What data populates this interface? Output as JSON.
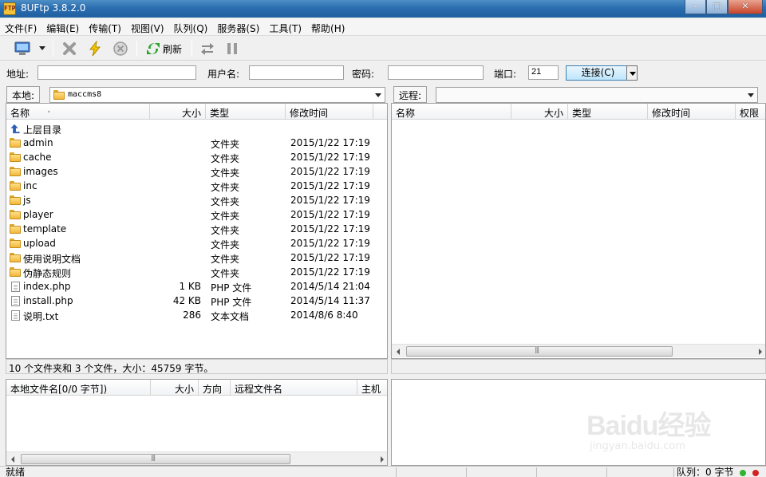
{
  "window": {
    "title": "8UFtp 3.8.2.0",
    "icon_text": "FTP"
  },
  "menu": [
    "文件(F)",
    "编辑(E)",
    "传输(T)",
    "视图(V)",
    "队列(Q)",
    "服务器(S)",
    "工具(T)",
    "帮助(H)"
  ],
  "toolbar": {
    "refresh_label": "刷新"
  },
  "connect": {
    "address_label": "地址:",
    "address_value": "",
    "user_label": "用户名:",
    "user_value": "",
    "password_label": "密码:",
    "password_value": "",
    "port_label": "端口:",
    "port_value": "21",
    "connect_button": "连接(C)"
  },
  "local": {
    "path_label": "本地:",
    "path_value": "maccms8",
    "columns": [
      "名称",
      "大小",
      "类型",
      "修改时间"
    ],
    "parent_dir": "上层目录",
    "files": [
      {
        "name": "admin",
        "size": "",
        "type": "文件夹",
        "modified": "2015/1/22 17:19",
        "icon": "folder-icon"
      },
      {
        "name": "cache",
        "size": "",
        "type": "文件夹",
        "modified": "2015/1/22 17:19",
        "icon": "folder-icon"
      },
      {
        "name": "images",
        "size": "",
        "type": "文件夹",
        "modified": "2015/1/22 17:19",
        "icon": "folder-icon"
      },
      {
        "name": "inc",
        "size": "",
        "type": "文件夹",
        "modified": "2015/1/22 17:19",
        "icon": "folder-icon"
      },
      {
        "name": "js",
        "size": "",
        "type": "文件夹",
        "modified": "2015/1/22 17:19",
        "icon": "folder-icon"
      },
      {
        "name": "player",
        "size": "",
        "type": "文件夹",
        "modified": "2015/1/22 17:19",
        "icon": "folder-icon"
      },
      {
        "name": "template",
        "size": "",
        "type": "文件夹",
        "modified": "2015/1/22 17:19",
        "icon": "folder-icon"
      },
      {
        "name": "upload",
        "size": "",
        "type": "文件夹",
        "modified": "2015/1/22 17:19",
        "icon": "folder-icon"
      },
      {
        "name": "使用说明文档",
        "size": "",
        "type": "文件夹",
        "modified": "2015/1/22 17:19",
        "icon": "folder-icon"
      },
      {
        "name": "伪静态规则",
        "size": "",
        "type": "文件夹",
        "modified": "2015/1/22 17:19",
        "icon": "folder-icon"
      },
      {
        "name": "index.php",
        "size": "1 KB",
        "type": "PHP 文件",
        "modified": "2014/5/14 21:04",
        "icon": "file-icon"
      },
      {
        "name": "install.php",
        "size": "42 KB",
        "type": "PHP 文件",
        "modified": "2014/5/14 11:37",
        "icon": "file-icon"
      },
      {
        "name": "说明.txt",
        "size": "286",
        "type": "文本文档",
        "modified": "2014/8/6 8:40",
        "icon": "file-icon"
      }
    ],
    "status": "10 个文件夹和 3 个文件，大小：45759 字节。"
  },
  "remote": {
    "path_label": "远程:",
    "path_value": "",
    "columns": [
      "名称",
      "大小",
      "类型",
      "修改时间",
      "权限"
    ]
  },
  "queue": {
    "columns": [
      "本地文件名[0/0 字节])",
      "大小",
      "方向",
      "远程文件名",
      "主机"
    ]
  },
  "statusbar": {
    "ready": "就绪",
    "queue": "队列：0 字节"
  },
  "watermark": {
    "text": "Baidu经验",
    "sub": "jingyan.baidu.com"
  },
  "colors": {
    "title_bar": "#2b6eb0",
    "connect_button": "#bee6fd",
    "folder": "#f2b73a",
    "status_green": "#2fb52f",
    "status_red": "#d42020"
  }
}
